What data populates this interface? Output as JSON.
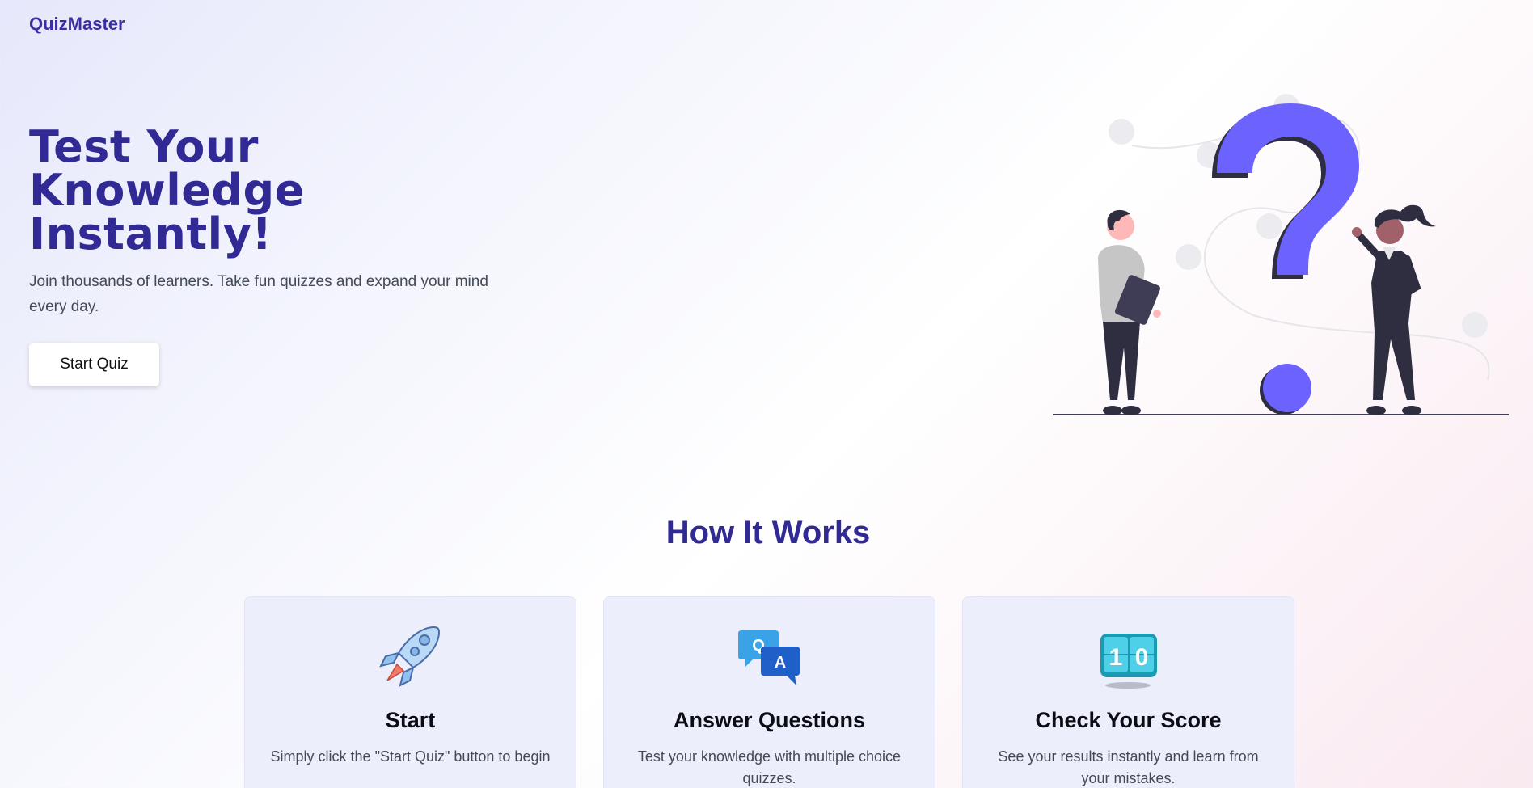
{
  "brand": "QuizMaster",
  "hero": {
    "title_lines": [
      "Test Your",
      "Knowledge",
      "Instantly!"
    ],
    "subtitle": "Join thousands of learners. Take fun quizzes and expand your mind every day.",
    "cta_label": "Start Quiz"
  },
  "how_it_works": {
    "title": "How It Works",
    "steps": [
      {
        "icon": "rocket-icon",
        "title": "Start",
        "text": "Simply click the \"Start Quiz\" button to begin"
      },
      {
        "icon": "qa-chat-icon",
        "title": "Answer Questions",
        "text": "Test your knowledge with multiple choice quizzes."
      },
      {
        "icon": "score-counter-icon",
        "title": "Check Your Score",
        "text": "See your results instantly and learn from your mistakes."
      }
    ]
  },
  "colors": {
    "brand_primary": "#312a94",
    "accent_purple": "#6c63ff",
    "card_bg": "#eceefc",
    "body_text": "#444a55"
  }
}
